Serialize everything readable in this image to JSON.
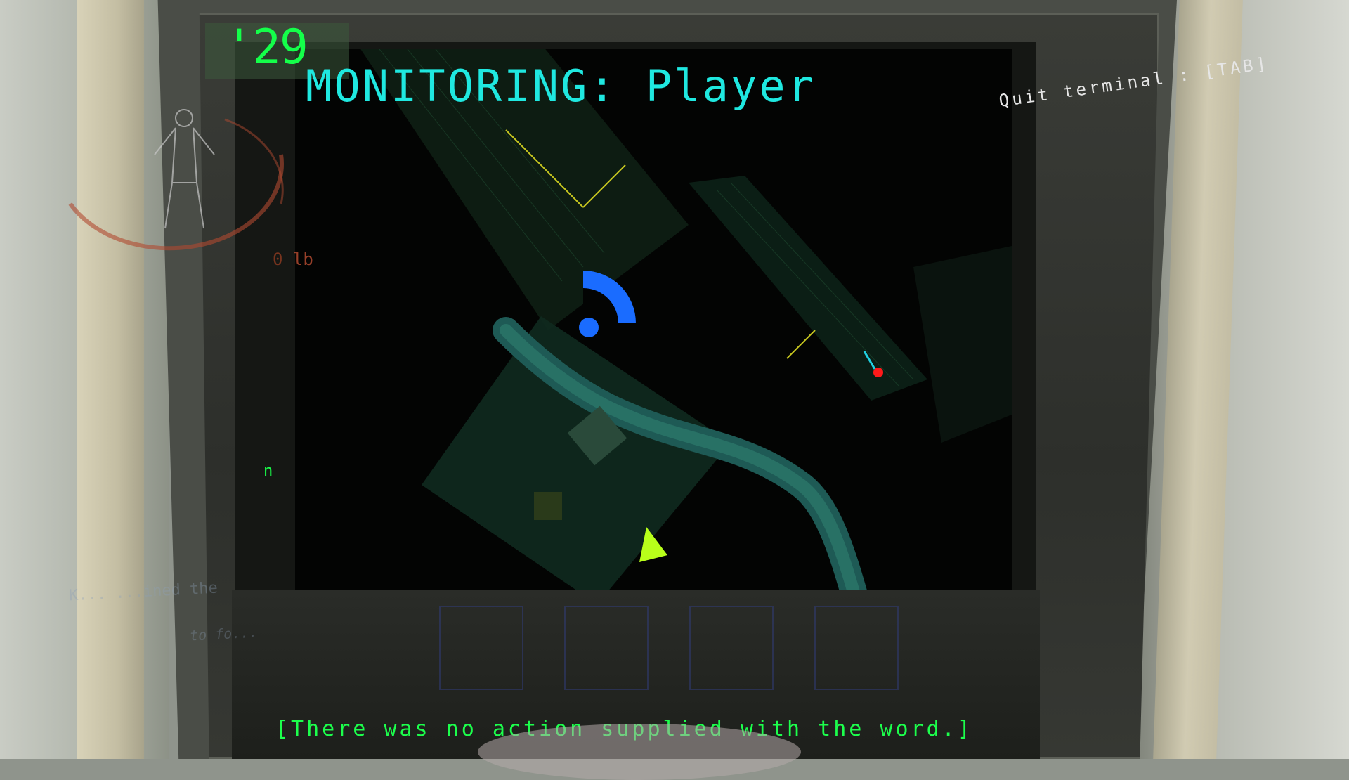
{
  "hud": {
    "timer": "'29",
    "weight_value": "0",
    "weight_unit": "lb",
    "scroll_hint": "n"
  },
  "terminal": {
    "monitoring_label": "MONITORING: Player",
    "quit_hint": "Quit terminal : [TAB]",
    "message": "[There was no action supplied with the word.]"
  },
  "chat": {
    "line1": "K... ...ined the",
    "line2": "to fo..."
  },
  "inventory": {
    "slot_count": 4
  },
  "map": {
    "player_marker_color": "#1a6cff",
    "enemy_marker_color": "#ff1a1a",
    "ship_marker_color": "#b8ff1a",
    "terrain_icon": "player-radar-icon"
  },
  "colors": {
    "terminal_green": "#1cff4c",
    "monitor_cyan": "#1fe8e0",
    "hud_orange": "#b04a30"
  }
}
